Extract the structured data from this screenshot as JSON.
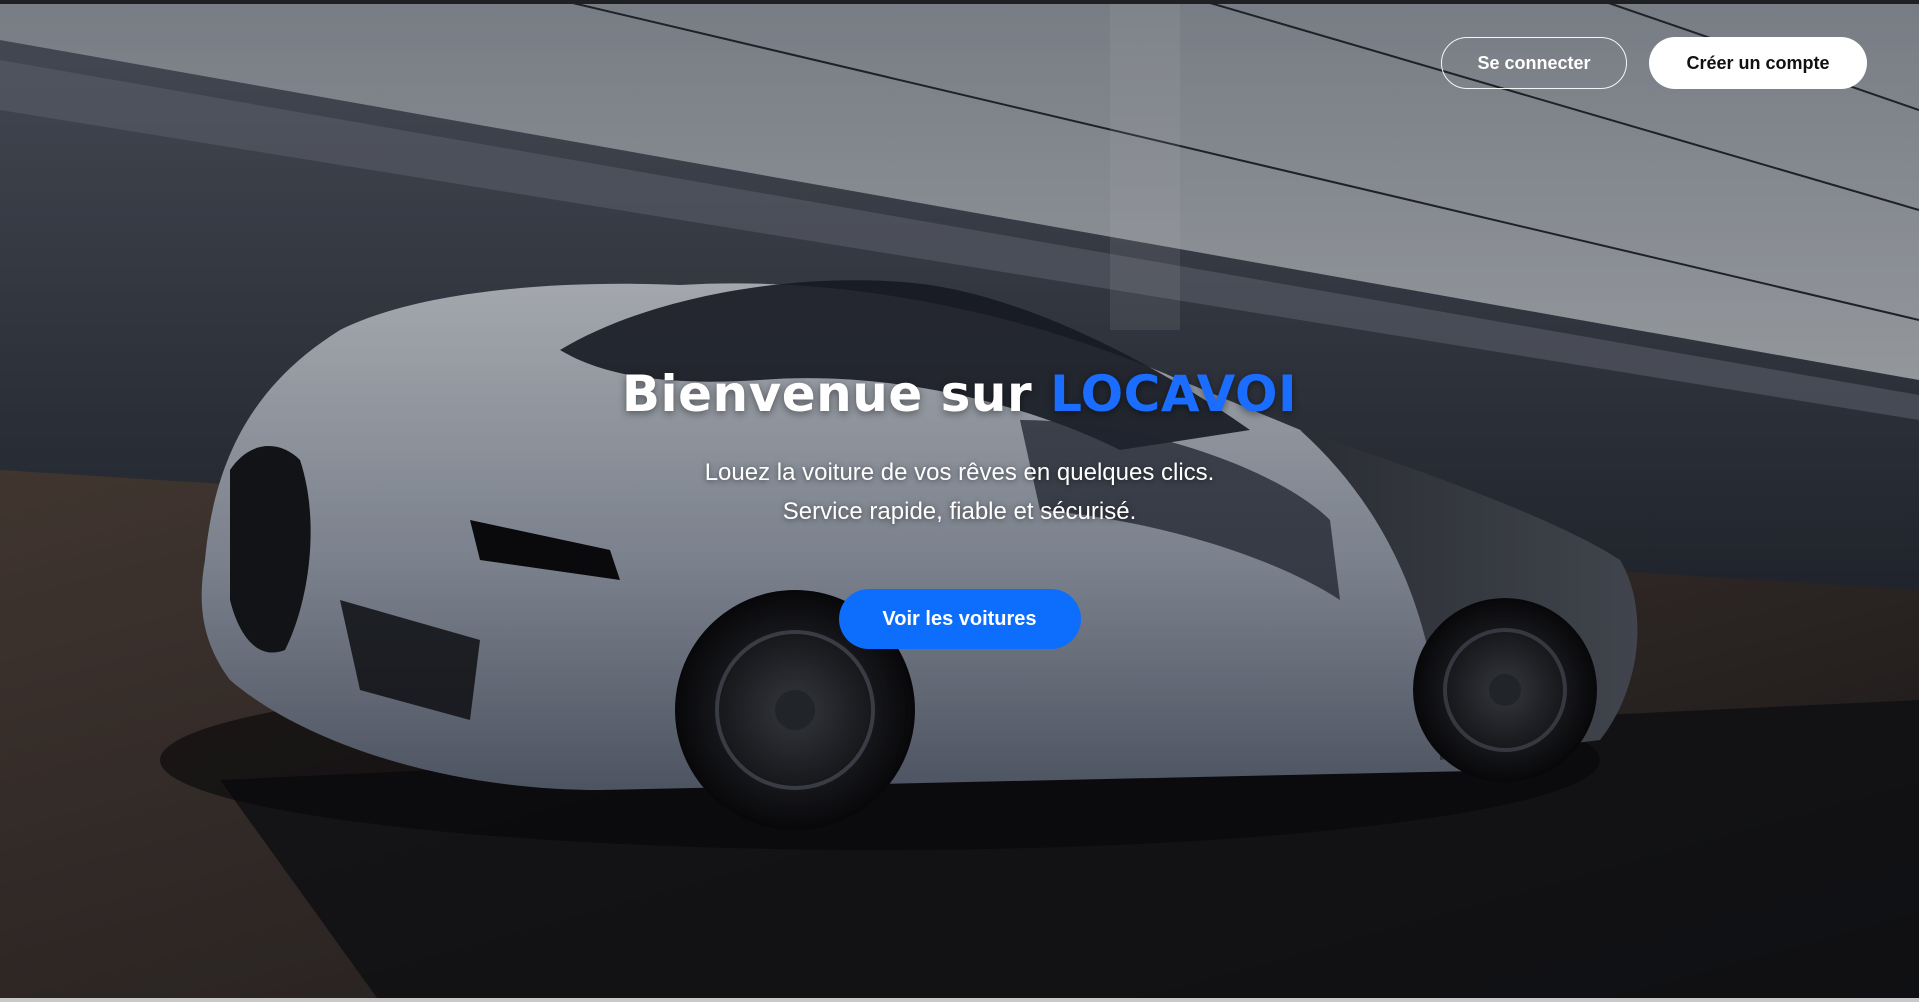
{
  "header": {
    "login_label": "Se connecter",
    "signup_label": "Créer un compte"
  },
  "hero": {
    "title_prefix": "Bienvenue sur ",
    "brand_name": "LOCAVOI",
    "subtitle_line1": "Louez la voiture de vos rêves en quelques clics.",
    "subtitle_line2": "Service rapide, fiable et sécurisé.",
    "cta_label": "Voir les voitures",
    "background_image": "silver-sports-car-photo"
  },
  "colors": {
    "brand": "#1a6dff",
    "cta": "#0d6efd",
    "text": "#ffffff",
    "signup_bg": "#ffffff"
  }
}
